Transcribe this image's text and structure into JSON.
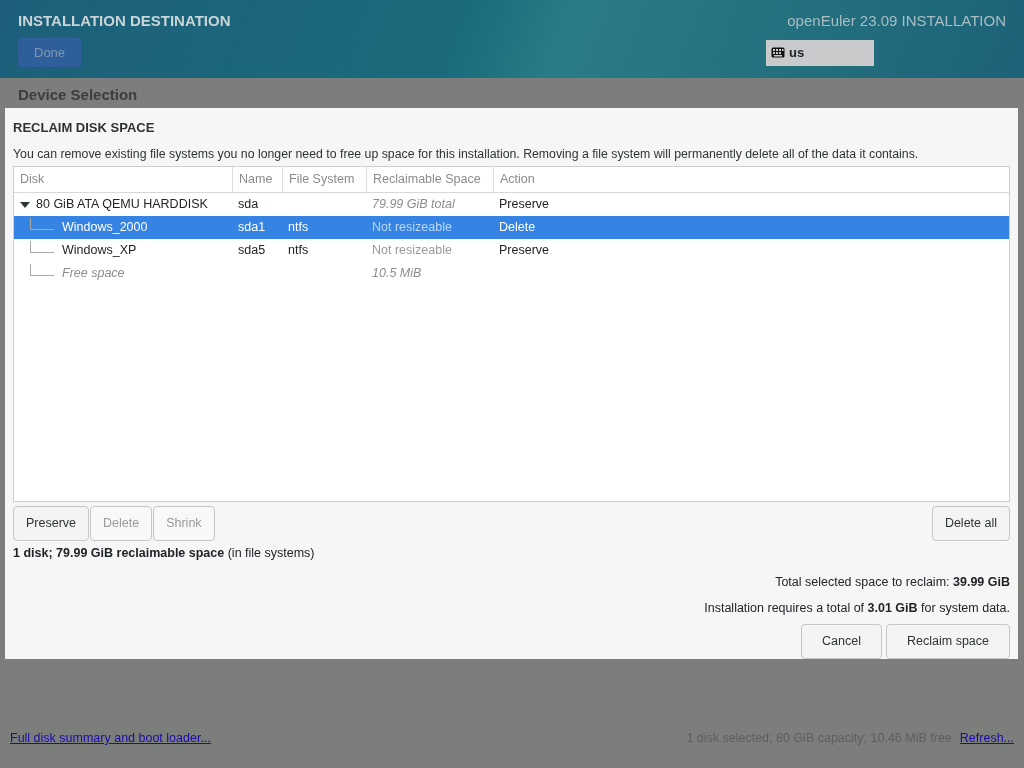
{
  "header": {
    "title": "INSTALLATION DESTINATION",
    "done_button": {
      "label": "Done",
      "disabled": true
    },
    "product": "openEuler 23.09 INSTALLATION",
    "keyboard": "us"
  },
  "section_title": "Device Selection",
  "dialog": {
    "title": "RECLAIM DISK SPACE",
    "description": "You can remove existing file systems you no longer need to free up space for this installation.  Removing a file system will permanently delete all of the data it contains.",
    "table": {
      "columns": [
        "Disk",
        "Name",
        "File System",
        "Reclaimable Space",
        "Action"
      ],
      "rows": [
        {
          "kind": "disk",
          "disk": "80 GiB ATA QEMU HARDDISK",
          "name": "sda",
          "file_system": "",
          "reclaimable": "79.99 GiB total",
          "action": "Preserve",
          "expanded": true,
          "selected": false,
          "children": [
            {
              "kind": "partition",
              "disk": "Windows_2000",
              "name": "sda1",
              "file_system": "ntfs",
              "reclaimable": "Not resizeable",
              "action": "Delete",
              "selected": true
            },
            {
              "kind": "partition",
              "disk": "Windows_XP",
              "name": "sda5",
              "file_system": "ntfs",
              "reclaimable": "Not resizeable",
              "action": "Preserve",
              "selected": false
            },
            {
              "kind": "free",
              "disk": "Free space",
              "reclaimable": "10.5 MiB",
              "selected": false
            }
          ]
        }
      ]
    },
    "row_buttons": [
      {
        "label": "Preserve",
        "disabled": false
      },
      {
        "label": "Delete",
        "disabled": true
      },
      {
        "label": "Shrink",
        "disabled": true
      }
    ],
    "delete_all": {
      "label": "Delete all",
      "disabled": false
    },
    "summary": "**1 disk; 79.99 GiB reclaimable space** (in file systems)",
    "total_selected": "Total selected space to reclaim: **39.99 GiB**",
    "requirement": "Installation requires a total of **3.01 GiB** for system data.",
    "buttons": [
      "Cancel",
      "Reclaim space"
    ]
  },
  "footer": {
    "link": "Full disk summary and boot loader...",
    "status": "1 disk selected; 80 GiB capacity; 10.46 MiB free",
    "refresh": "Refresh..."
  }
}
